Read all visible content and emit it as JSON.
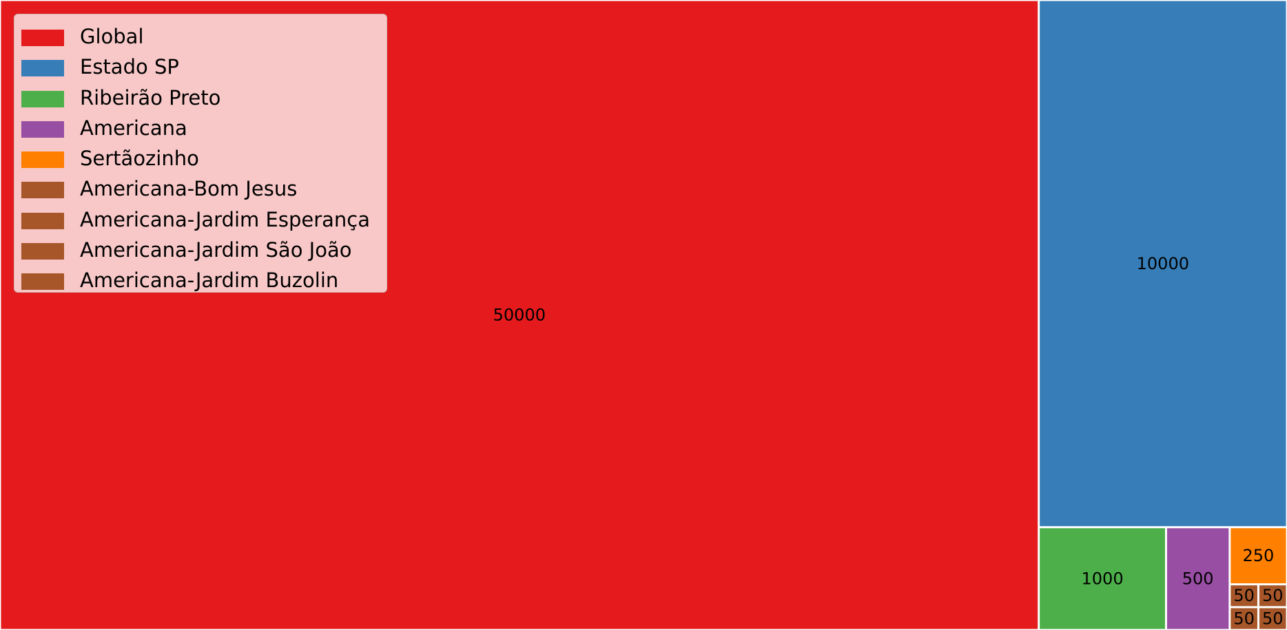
{
  "chart_data": {
    "type": "treemap",
    "title": "",
    "legend": {
      "position": "top-left",
      "entries": [
        {
          "label": "Global",
          "color": "#e41a1c"
        },
        {
          "label": "Estado SP",
          "color": "#377eb8"
        },
        {
          "label": "Ribeirão Preto",
          "color": "#4daf4a"
        },
        {
          "label": "Americana",
          "color": "#984ea3"
        },
        {
          "label": "Sertãozinho",
          "color": "#ff7f00"
        },
        {
          "label": "Americana-Bom Jesus",
          "color": "#a65628"
        },
        {
          "label": "Americana-Jardim Esperança",
          "color": "#a65628"
        },
        {
          "label": "Americana-Jardim São João",
          "color": "#a65628"
        },
        {
          "label": "Americana-Jardim Buzolin",
          "color": "#a65628"
        }
      ]
    },
    "tiles": [
      {
        "name": "Global",
        "value": 50000,
        "label": "50000",
        "color": "#e41a1c"
      },
      {
        "name": "Estado SP",
        "value": 10000,
        "label": "10000",
        "color": "#377eb8"
      },
      {
        "name": "Ribeirão Preto",
        "value": 1000,
        "label": "1000",
        "color": "#4daf4a"
      },
      {
        "name": "Americana",
        "value": 500,
        "label": "500",
        "color": "#984ea3"
      },
      {
        "name": "Sertãozinho",
        "value": 250,
        "label": "250",
        "color": "#ff7f00"
      },
      {
        "name": "Americana-Bom Jesus",
        "value": 50,
        "label": "50",
        "color": "#a65628"
      },
      {
        "name": "Americana-Jardim Esperança",
        "value": 50,
        "label": "50",
        "color": "#a65628"
      },
      {
        "name": "Americana-Jardim São João",
        "value": 50,
        "label": "50",
        "color": "#a65628"
      },
      {
        "name": "Americana-Jardim Buzolin",
        "value": 50,
        "label": "50",
        "color": "#a65628"
      }
    ]
  }
}
